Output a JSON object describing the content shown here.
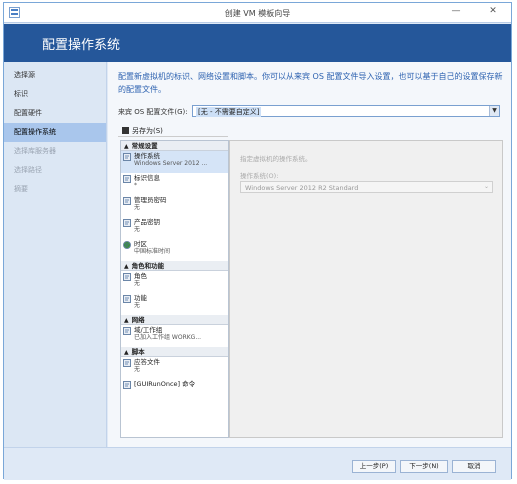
{
  "window": {
    "title": "创建 VM 模板向导",
    "minimize": "—",
    "close": "✕"
  },
  "header": {
    "title": "配置操作系统"
  },
  "nav": {
    "items": [
      {
        "label": "选择源",
        "state": "normal"
      },
      {
        "label": "标识",
        "state": "normal"
      },
      {
        "label": "配置硬件",
        "state": "normal"
      },
      {
        "label": "配置操作系统",
        "state": "active"
      },
      {
        "label": "选择库服务器",
        "state": "disabled"
      },
      {
        "label": "选择路径",
        "state": "disabled"
      },
      {
        "label": "摘要",
        "state": "disabled"
      }
    ]
  },
  "main": {
    "description": "配置新虚拟机的标识、网络设置和脚本。你可以从来宾 OS 配置文件导入设置，也可以基于自己的设置保存新的配置文件。",
    "profile_label": "来宾 OS 配置文件(G):",
    "profile_value": "[无 - 不需要自定义]",
    "save_as": "另存为(S)"
  },
  "tree": {
    "groups": [
      {
        "name": "常规设置",
        "items": [
          {
            "label": "操作系统",
            "sub": "Windows Server 2012 ...",
            "icon": "os-icon",
            "selected": true
          },
          {
            "label": "标识信息",
            "sub": "*",
            "icon": "identity-icon",
            "selected": false
          },
          {
            "label": "管理员密码",
            "sub": "无",
            "icon": "admin-password-icon",
            "selected": false
          },
          {
            "label": "产品密钥",
            "sub": "无",
            "icon": "product-key-icon",
            "selected": false
          },
          {
            "label": "时区",
            "sub": "中国标准时间",
            "icon": "timezone-icon",
            "selected": false
          }
        ]
      },
      {
        "name": "角色和功能",
        "items": [
          {
            "label": "角色",
            "sub": "无",
            "icon": "roles-icon",
            "selected": false
          },
          {
            "label": "功能",
            "sub": "无",
            "icon": "features-icon",
            "selected": false
          }
        ]
      },
      {
        "name": "网络",
        "items": [
          {
            "label": "域/工作组",
            "sub": "已加入工作组 WORKG...",
            "icon": "domain-icon",
            "selected": false
          }
        ]
      },
      {
        "name": "脚本",
        "items": [
          {
            "label": "应答文件",
            "sub": "无",
            "icon": "answer-file-icon",
            "selected": false
          },
          {
            "label": "[GUIRunOnce] 命令",
            "sub": "",
            "icon": "runonce-icon",
            "selected": false
          }
        ]
      }
    ]
  },
  "details": {
    "hint": "指定虚拟机的操作系统。",
    "os_label": "操作系统(O):",
    "os_value": "Windows Server 2012 R2 Standard"
  },
  "footer": {
    "prev": "上一步(P)",
    "next": "下一步(N)",
    "cancel": "取消"
  },
  "colors": {
    "header": "#25579a",
    "accent_text": "#2d62b0",
    "nav_active": "#a9c6ec"
  }
}
